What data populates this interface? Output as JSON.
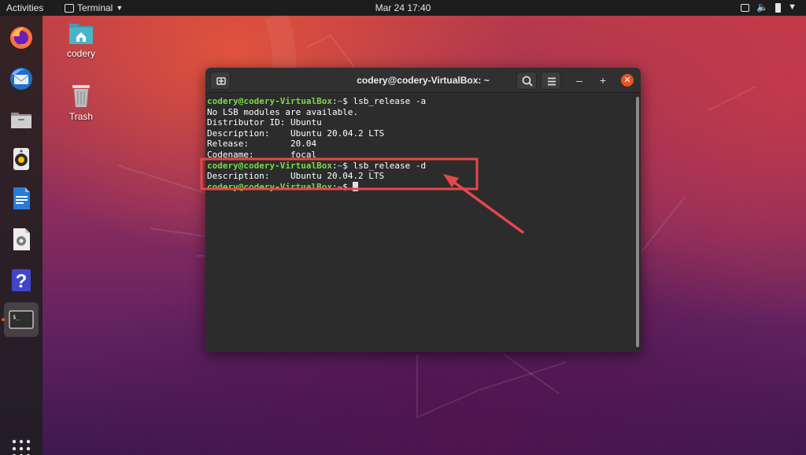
{
  "topbar": {
    "activities": "Activities",
    "app_menu": "Terminal",
    "clock": "Mar 24  17:40"
  },
  "dock": {
    "items": [
      {
        "name": "firefox-icon"
      },
      {
        "name": "thunderbird-icon"
      },
      {
        "name": "files-icon"
      },
      {
        "name": "rhythmbox-icon"
      },
      {
        "name": "libreoffice-writer-icon"
      },
      {
        "name": "software-icon"
      },
      {
        "name": "help-icon"
      },
      {
        "name": "terminal-icon",
        "active": true
      }
    ],
    "show_apps": "apps-grid-icon"
  },
  "desktop": {
    "icons": [
      {
        "label": "codery",
        "icon": "home-folder-icon"
      },
      {
        "label": "Trash",
        "icon": "trash-icon"
      }
    ]
  },
  "terminal": {
    "title": "codery@codery-VirtualBox: ~",
    "lines": [
      {
        "type": "prompt",
        "user": "codery@codery-VirtualBox",
        "sep": ":",
        "path": "~",
        "sign": "$ ",
        "cmd": "lsb_release -a"
      },
      {
        "type": "output",
        "text": "No LSB modules are available."
      },
      {
        "type": "output",
        "text": "Distributor ID:\tUbuntu"
      },
      {
        "type": "output",
        "text": "Description:\tUbuntu 20.04.2 LTS"
      },
      {
        "type": "output",
        "text": "Release:\t20.04"
      },
      {
        "type": "output",
        "text": "Codename:\tfocal"
      },
      {
        "type": "prompt",
        "user": "codery@codery-VirtualBox",
        "sep": ":",
        "path": "~",
        "sign": "$ ",
        "cmd": "lsb_release -d"
      },
      {
        "type": "output",
        "text": "Description:\tUbuntu 20.04.2 LTS"
      },
      {
        "type": "prompt",
        "user": "codery@codery-VirtualBox",
        "sep": ":",
        "path": "~",
        "sign": "$ ",
        "cmd": "",
        "cursor": true
      }
    ]
  },
  "colors": {
    "accent": "#e95420",
    "prompt_user": "#7bd84a",
    "prompt_path": "#8b9cf7",
    "annotation": "#e8474a"
  }
}
